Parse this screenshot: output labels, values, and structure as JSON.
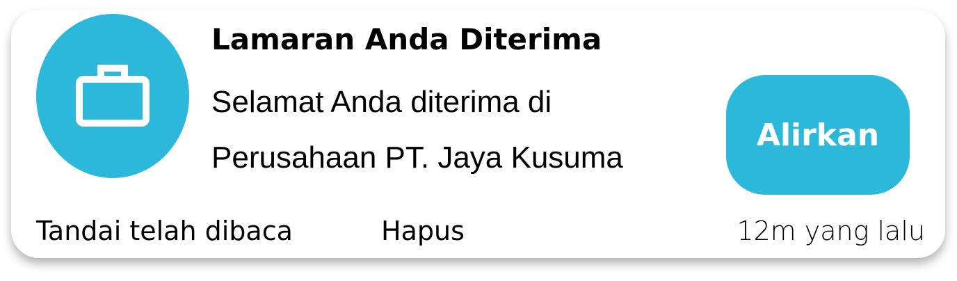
{
  "notification": {
    "icon": "briefcase-icon",
    "title": "Lamaran Anda Diterima",
    "message_line1": "Selamat Anda diterima di",
    "message_line2": "Perusahaan PT. Jaya Kusuma",
    "action_label": "Alirkan",
    "mark_read_label": "Tandai telah dibaca",
    "delete_label": "Hapus",
    "timestamp": "12m yang lalu"
  },
  "colors": {
    "accent": "#2cb8db",
    "text": "#000000",
    "background": "#ffffff"
  }
}
